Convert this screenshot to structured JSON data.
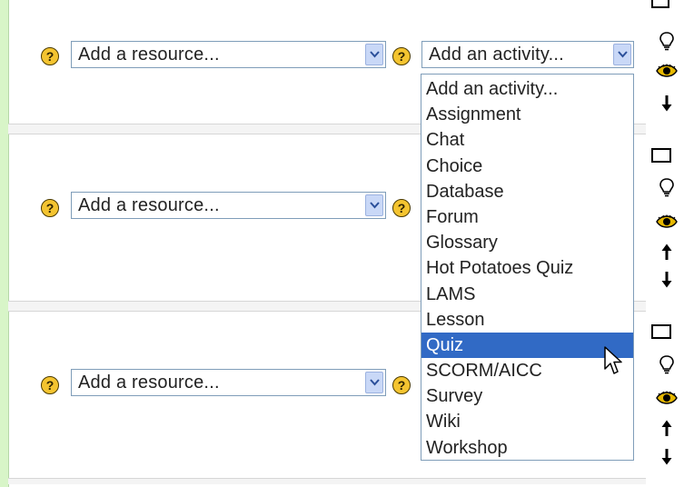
{
  "resource_placeholder": "Add a resource...",
  "activity_placeholder": "Add an activity...",
  "help_glyph": "?",
  "activity_options": [
    "Add an activity...",
    "Assignment",
    "Chat",
    "Choice",
    "Database",
    "Forum",
    "Glossary",
    "Hot Potatoes Quiz",
    "LAMS",
    "Lesson",
    "Quiz",
    "SCORM/AICC",
    "Survey",
    "Wiki",
    "Workshop"
  ],
  "selected_option": "Quiz",
  "icons": {
    "section": [
      "highlight-box-icon",
      "lightbulb-icon",
      "eye-icon",
      "move-up-icon",
      "move-down-icon"
    ],
    "help": "help-icon",
    "dropdown_arrow": "chevron-down-icon"
  },
  "colors": {
    "page_border": "#d8f5c8",
    "selected_bg": "#316ac5",
    "help_icon": "#f4c430",
    "select_border": "#7f9db9"
  }
}
